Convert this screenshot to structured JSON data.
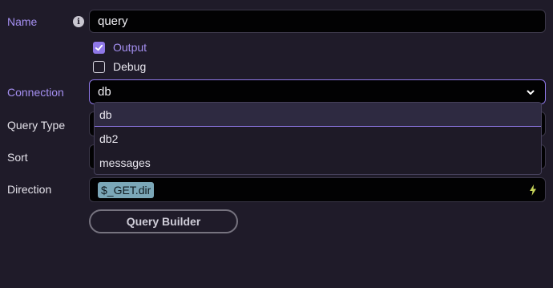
{
  "form": {
    "name": {
      "label": "Name",
      "value": "query"
    },
    "output": {
      "label": "Output",
      "checked": true
    },
    "debug": {
      "label": "Debug",
      "checked": false
    },
    "connection": {
      "label": "Connection",
      "value": "db",
      "options": [
        "db",
        "db2",
        "messages"
      ]
    },
    "query_type": {
      "label": "Query Type"
    },
    "sort": {
      "label": "Sort"
    },
    "direction": {
      "label": "Direction",
      "token": "$_GET.dir"
    },
    "query_builder_label": "Query Builder"
  },
  "icons": {
    "info": "info-icon",
    "check": "check-icon",
    "chevron": "chevron-down-icon",
    "bolt": "lightning-bolt-icon"
  },
  "colors": {
    "background": "#1f1b29",
    "accent": "#8f78e8",
    "accent_label": "#a48ff0",
    "token": "#7ba7b8",
    "bolt": "#c8d65a"
  }
}
